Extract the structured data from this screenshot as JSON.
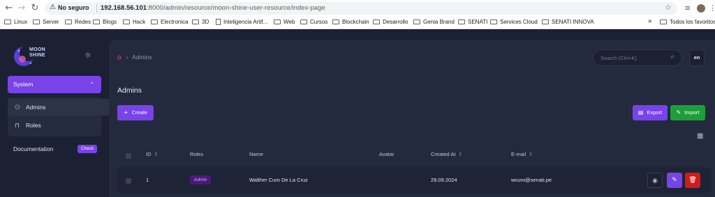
{
  "browser": {
    "security_label": "No seguro",
    "url_host": "192.168.56.101",
    "url_path": ":8000/admin/resource/moon-shine-user-resource/index-page",
    "bookmarks": [
      {
        "label": "Linux",
        "type": "folder"
      },
      {
        "label": "Server",
        "type": "folder"
      },
      {
        "label": "Redes",
        "type": "folder"
      },
      {
        "label": "Blogs",
        "type": "folder"
      },
      {
        "label": "Hack",
        "type": "folder"
      },
      {
        "label": "Electronica",
        "type": "folder"
      },
      {
        "label": "3D",
        "type": "folder"
      },
      {
        "label": "Inteligencia Artif...",
        "type": "folder"
      },
      {
        "label": "Web",
        "type": "folder"
      },
      {
        "label": "Cursos",
        "type": "folder"
      },
      {
        "label": "Blockchain",
        "type": "folder"
      },
      {
        "label": "Desarrollo",
        "type": "folder"
      },
      {
        "label": "Genia Brand",
        "type": "folder"
      },
      {
        "label": "SENATI",
        "type": "folder"
      },
      {
        "label": "Services Cloud",
        "type": "folder"
      },
      {
        "label": "SENATI INNOVA",
        "type": "folder"
      }
    ],
    "overflow": "»",
    "all_bookmarks": "Todos los favoritos"
  },
  "sidebar": {
    "logo_text_1": "MOON",
    "logo_text_2": "SHINE",
    "system_label": "System",
    "items": [
      {
        "label": "Admins",
        "icon": "users-icon"
      },
      {
        "label": "Roles",
        "icon": "bookmark-icon"
      }
    ],
    "documentation_label": "Documentation",
    "documentation_badge": "Check"
  },
  "header": {
    "breadcrumb_current": "Admins",
    "search_placeholder": "Search (Ctrl+K)",
    "lang": "en"
  },
  "page": {
    "title": "Admins",
    "create_label": "Create",
    "export_label": "Export",
    "import_label": "Import"
  },
  "table": {
    "columns": {
      "id": "ID",
      "roles": "Roles",
      "name": "Name",
      "avatar": "Avatar",
      "created_at": "Created At",
      "email": "E-mail"
    },
    "rows": [
      {
        "id": "1",
        "role": "Admin",
        "name": "Walther Curo De La Cruz",
        "created_at": "29.09.2024",
        "email": "wcuro@senati.pe"
      }
    ]
  },
  "colors": {
    "accent": "#7843e9",
    "success": "#1e9e3a",
    "danger": "#d11b1b",
    "background": "#1b2132",
    "panel": "#232a3d"
  }
}
